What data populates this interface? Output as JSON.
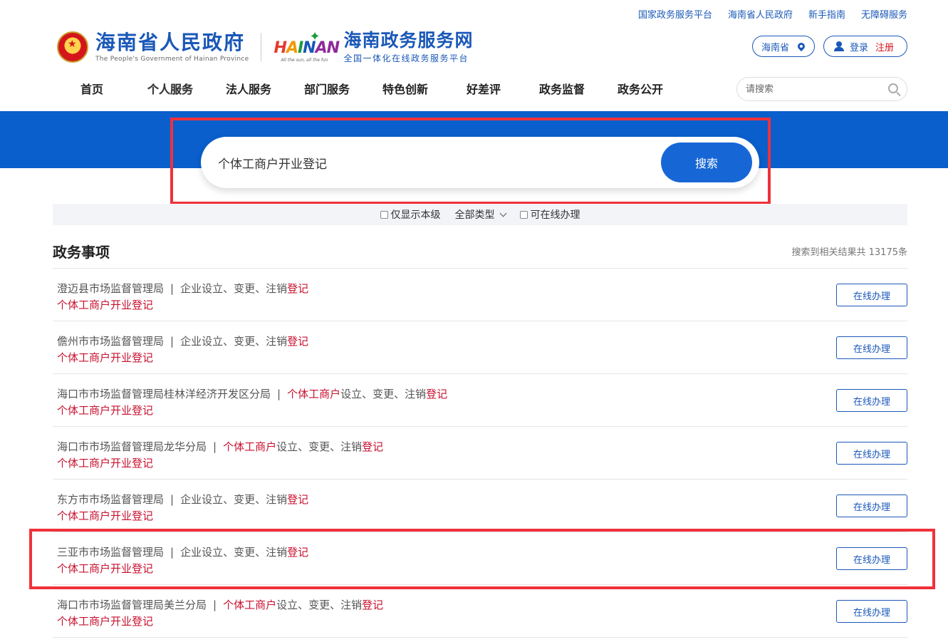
{
  "top_links": [
    "国家政务服务平台",
    "海南省人民政府",
    "新手指南",
    "无障碍服务"
  ],
  "header": {
    "gov_cn": "海南省人民政府",
    "gov_en": "The People's Government of Hainan Province",
    "hn_logo_word": [
      "H",
      "A",
      "I",
      "N",
      "AN"
    ],
    "hn_logo_tag": "All the sun, all the fun",
    "svc_cn": "海南政务服务网",
    "svc_sub": "全国一体化在线政务服务平台",
    "region": "海南省",
    "login": "登录",
    "register": "注册"
  },
  "nav": {
    "items": [
      "首页",
      "个人服务",
      "法人服务",
      "部门服务",
      "特色创新",
      "好差评",
      "政务监督",
      "政务公开"
    ],
    "search_placeholder": "请搜索"
  },
  "search": {
    "query": "个体工商户开业登记",
    "button": "搜索"
  },
  "filters": {
    "only_this_level": "仅显示本级",
    "all_types": "全部类型",
    "online_only": "可在线办理"
  },
  "section": {
    "title": "政务事项",
    "count_text": "搜索到相关结果共 13175条"
  },
  "results": [
    {
      "dept": "澄迈县市场监督管理局",
      "cat_pre": "",
      "cat_hl": "",
      "cat_mid": "企业设立、变更、注销",
      "cat_end": "登记",
      "name": "个体工商户开业登记",
      "action": "在线办理"
    },
    {
      "dept": "儋州市市场监督管理局",
      "cat_pre": "",
      "cat_hl": "",
      "cat_mid": "企业设立、变更、注销",
      "cat_end": "登记",
      "name": "个体工商户开业登记",
      "action": "在线办理"
    },
    {
      "dept": "海口市市场监督管理局桂林洋经济开发区分局",
      "cat_pre": "",
      "cat_hl": "个体工商户",
      "cat_mid": "设立、变更、注销",
      "cat_end": "登记",
      "name": "个体工商户开业登记",
      "action": "在线办理"
    },
    {
      "dept": "海口市市场监督管理局龙华分局",
      "cat_pre": "",
      "cat_hl": "个体工商户",
      "cat_mid": "设立、变更、注销",
      "cat_end": "登记",
      "name": "个体工商户开业登记",
      "action": "在线办理"
    },
    {
      "dept": "东方市市场监督管理局",
      "cat_pre": "",
      "cat_hl": "",
      "cat_mid": "企业设立、变更、注销",
      "cat_end": "登记",
      "name": "个体工商户开业登记",
      "action": "在线办理"
    },
    {
      "dept": "三亚市市场监督管理局",
      "cat_pre": "",
      "cat_hl": "",
      "cat_mid": "企业设立、变更、注销",
      "cat_end": "登记",
      "name": "个体工商户开业登记",
      "action": "在线办理"
    },
    {
      "dept": "海口市市场监督管理局美兰分局",
      "cat_pre": "",
      "cat_hl": "个体工商户",
      "cat_mid": "设立、变更、注销",
      "cat_end": "登记",
      "name": "个体工商户开业登记",
      "action": "在线办理"
    }
  ],
  "colors": {
    "brand_blue": "#1a58b8",
    "banner_blue": "#0a5fcc",
    "highlight_red": "#c8102e",
    "annotation_red": "#f0313a"
  }
}
